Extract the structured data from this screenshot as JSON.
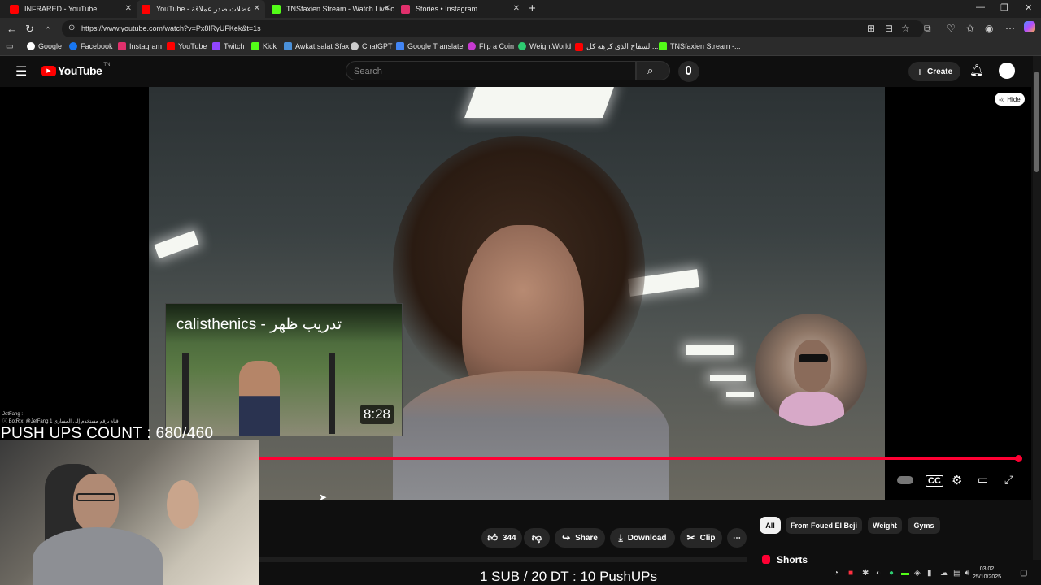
{
  "browser": {
    "tabs": [
      {
        "title": "INFRARED - YouTube",
        "color": "#ff0000"
      },
      {
        "title": "YouTube - عضلات صدر عملاقة",
        "color": "#ff0000"
      },
      {
        "title": "TNSfaxien Stream - Watch Live o",
        "color": "#53fc18"
      },
      {
        "title": "Stories • Instagram",
        "color": "#e1306c"
      }
    ],
    "url": "https://www.youtube.com/watch?v=Px8IRyUFKek&t=1s",
    "bookmarks": [
      {
        "label": "Google",
        "color": "#ffffff"
      },
      {
        "label": "Facebook",
        "color": "#1877f2"
      },
      {
        "label": "Instagram",
        "color": "#e1306c"
      },
      {
        "label": "YouTube",
        "color": "#ff0000"
      },
      {
        "label": "Twitch",
        "color": "#9146ff"
      },
      {
        "label": "Kick",
        "color": "#53fc18"
      },
      {
        "label": "Awkat salat Sfax",
        "color": "#4a90d9"
      },
      {
        "label": "ChatGPT",
        "color": "#cccccc"
      },
      {
        "label": "Google Translate",
        "color": "#4285f4"
      },
      {
        "label": "Flip a Coin",
        "color": "#c73ad1"
      },
      {
        "label": "WeightWorld",
        "color": "#2ecc71"
      },
      {
        "label": "السفاح الذي كرهه كل...",
        "color": "#ff0000"
      },
      {
        "label": "TNSfaxien Stream -...",
        "color": "#53fc18"
      }
    ]
  },
  "youtube": {
    "logo_text": "YouTube",
    "region": "TN",
    "search_placeholder": "Search",
    "create_label": "Create",
    "hide_label": "Hide",
    "progress_fraction": 0.99
  },
  "overlay": {
    "chat_user": "JetFang :",
    "chat_line": "ⓘ BotRix: @JetFang 1 قناة برقم مستخدم إلى المساري",
    "pushups_count": "PUSH UPS COUNT : 680/460",
    "card_title": "calisthenics - تدريب ظهر",
    "card_duration": "8:28",
    "sub_text": "1 SUB / 20 DT : 10 PushUPs"
  },
  "actions": {
    "likes": "344",
    "share": "Share",
    "download": "Download",
    "clip": "Clip"
  },
  "chips": [
    "All",
    "From Foued El Beji",
    "Weight",
    "Gyms"
  ],
  "shorts_label": "Shorts",
  "clock": {
    "time": "03:02",
    "date": "25/10/2025"
  }
}
